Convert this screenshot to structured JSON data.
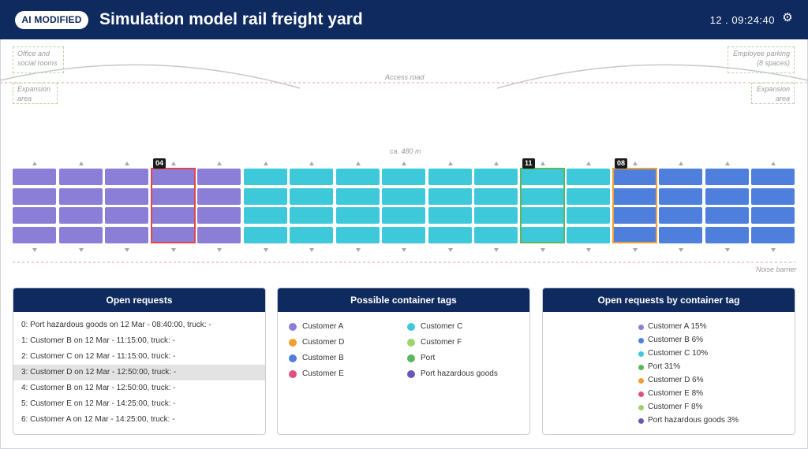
{
  "header": {
    "badge": "AI MODIFIED",
    "title": "Simulation model rail freight yard",
    "clock": "12 . 09:24:40",
    "settings_icon": "gear-icon"
  },
  "map": {
    "office": [
      "Office and",
      "social rooms"
    ],
    "parking": [
      "Employee parking",
      "(8 spaces)"
    ],
    "expansion_left": [
      "Expansion",
      "area"
    ],
    "expansion_right": [
      "Expansion",
      "area"
    ],
    "access_road": "Access road",
    "length": "ca. 480 m",
    "noise_barrier": "Noise barrier",
    "column_colors": [
      "#8b7ed6",
      "#8b7ed6",
      "#8b7ed6",
      "#8b7ed6",
      "#8b7ed6",
      "#3ec9da",
      "#3ec9da",
      "#3ec9da",
      "#3ec9da",
      "#3ec9da",
      "#3ec9da",
      "#3ec9da",
      "#3ec9da",
      "#4f7fdc",
      "#4f7fdc",
      "#4f7fdc",
      "#4f7fdc"
    ],
    "highlights": [
      {
        "column": 3,
        "tag": "04",
        "color": "#e0474c"
      },
      {
        "column": 11,
        "tag": "11",
        "color": "#5bb85c"
      },
      {
        "column": 13,
        "tag": "08",
        "color": "#f0a030"
      }
    ],
    "rows": 4
  },
  "open_requests": {
    "title": "Open requests",
    "selected_index": 3,
    "items": [
      "0: Port hazardous goods on 12 Mar - 08:40:00, truck: -",
      "1: Customer B on 12 Mar - 11:15:00, truck: -",
      "2: Customer C on 12 Mar - 11:15:00, truck: -",
      "3: Customer D on 12 Mar - 12:50:00, truck: -",
      "4: Customer B on 12 Mar - 12:50:00, truck: -",
      "5: Customer E on 12 Mar - 14:25:00, truck: -",
      "6: Customer A on 12 Mar - 14:25:00, truck: -"
    ]
  },
  "container_tags": {
    "title": "Possible container tags",
    "items": [
      {
        "label": "Customer A",
        "color": "#8b7ed6"
      },
      {
        "label": "Customer C",
        "color": "#3ec9da"
      },
      {
        "label": "Customer D",
        "color": "#f0a030"
      },
      {
        "label": "Customer F",
        "color": "#9bd46a"
      },
      {
        "label": "Customer B",
        "color": "#4f7fdc"
      },
      {
        "label": "Port",
        "color": "#5bb85c"
      },
      {
        "label": "Customer E",
        "color": "#e0527a"
      },
      {
        "label": "Port hazardous goods",
        "color": "#6a58b8"
      }
    ]
  },
  "requests_by_tag": {
    "title": "Open requests by container tag",
    "items": [
      {
        "label": "Customer A 15%",
        "color": "#8b7ed6"
      },
      {
        "label": "Customer B 6%",
        "color": "#4f7fdc"
      },
      {
        "label": "Customer C 10%",
        "color": "#3ec9da"
      },
      {
        "label": "Port 31%",
        "color": "#5bb85c"
      },
      {
        "label": "Customer D 6%",
        "color": "#f0a030"
      },
      {
        "label": "Customer E 8%",
        "color": "#e0527a"
      },
      {
        "label": "Customer F 8%",
        "color": "#9bd46a"
      },
      {
        "label": "Port hazardous goods 3%",
        "color": "#6a58b8"
      }
    ]
  }
}
